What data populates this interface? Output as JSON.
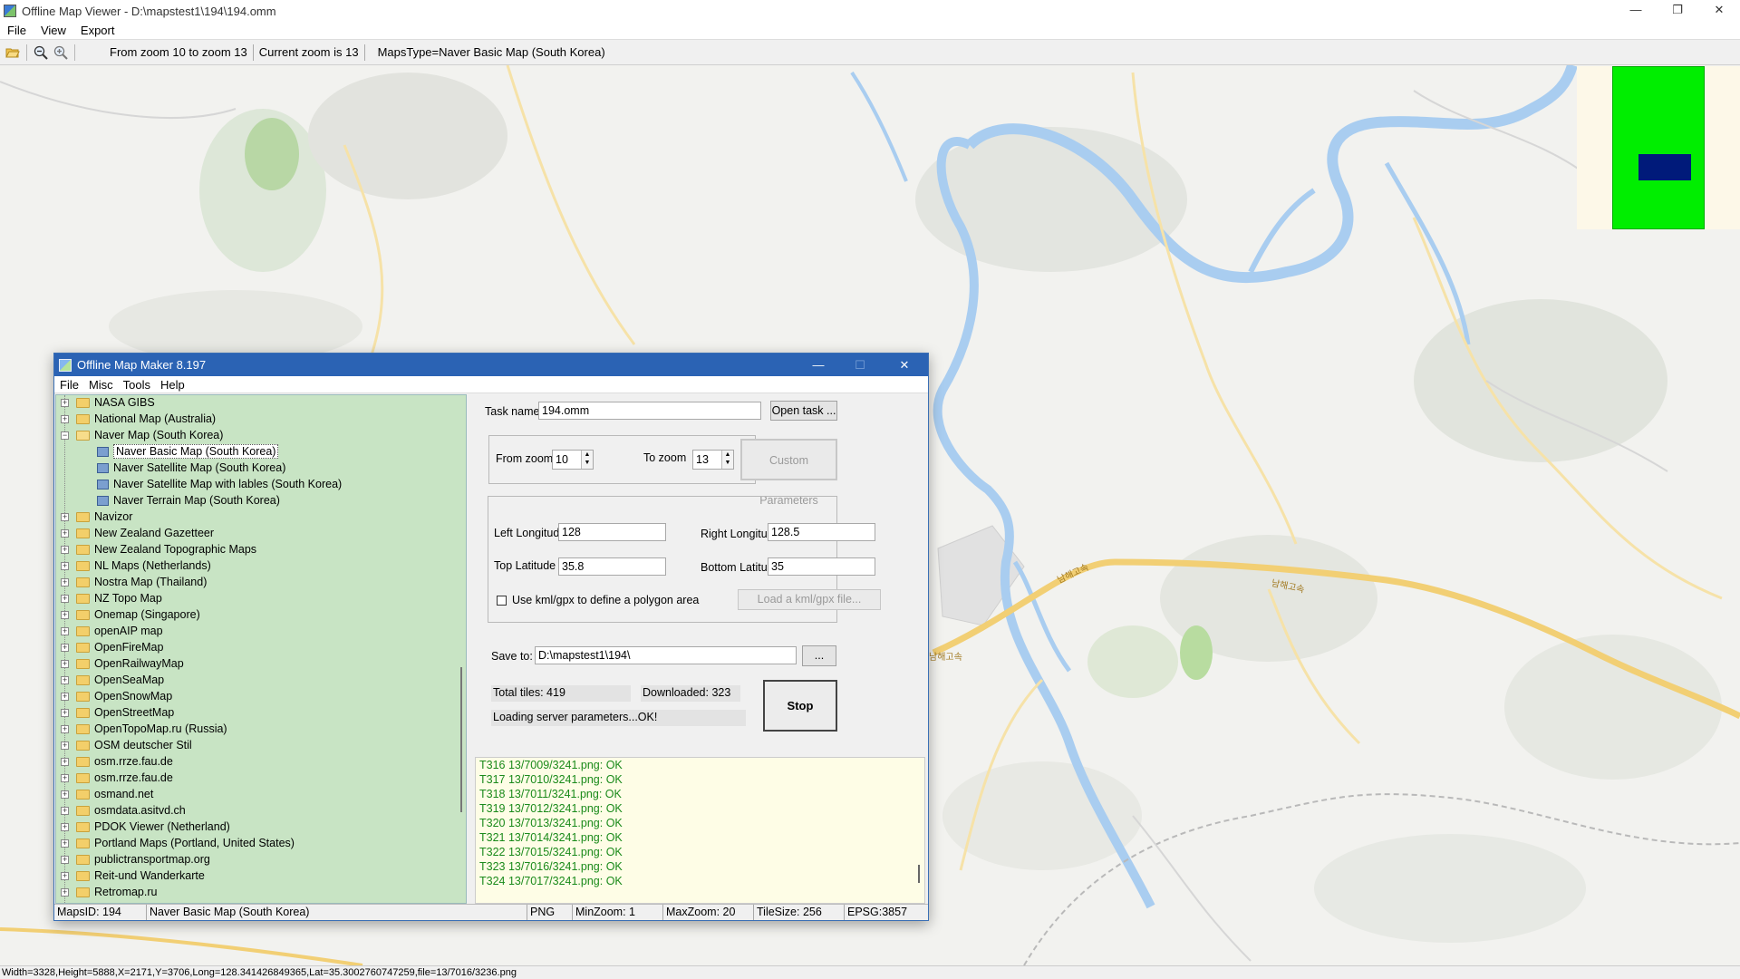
{
  "window": {
    "title": "Offline Map Viewer - D:\\mapstest1\\194\\194.omm",
    "controls": [
      "—",
      "❐",
      "✕"
    ]
  },
  "menu": [
    "File",
    "View",
    "Export"
  ],
  "toolbar": {
    "zoom_range": "From zoom 10 to zoom 13",
    "current_zoom": "Current zoom is 13",
    "maps_type": "MapsType=Naver Basic Map (South Korea)"
  },
  "map": {
    "labels": [
      "남해고속",
      "남해고속",
      "남해고속"
    ],
    "overview_colors": {
      "background": "#fdf8e8",
      "area": "#00ee00",
      "view": "#001a7a"
    }
  },
  "statusbar": {
    "text": "Width=3328,Height=5888,X=2171,Y=3706,Long=128.341426849365,Lat=35.3002760747259,file=13/7016/3236.png"
  },
  "dialog": {
    "title": "Offline Map Maker 8.197",
    "controls": [
      "—",
      "☐",
      "✕"
    ],
    "menu": [
      "File",
      "Misc",
      "Tools",
      "Help"
    ],
    "tree": [
      {
        "label": "NASA GIBS",
        "expander": "+"
      },
      {
        "label": "National Map (Australia)",
        "expander": "+"
      },
      {
        "label": "Naver Map (South Korea)",
        "expander": "−",
        "open": true
      },
      {
        "label": "Naver Basic Map (South Korea)",
        "child": true,
        "selected": true
      },
      {
        "label": "Naver Satellite Map (South Korea)",
        "child": true
      },
      {
        "label": "Naver Satellite Map with lables (South Korea)",
        "child": true
      },
      {
        "label": "Naver Terrain Map (South Korea)",
        "child": true
      },
      {
        "label": "Navizor",
        "expander": "+"
      },
      {
        "label": "New Zealand Gazetteer",
        "expander": "+"
      },
      {
        "label": "New Zealand Topographic Maps",
        "expander": "+"
      },
      {
        "label": "NL Maps (Netherlands)",
        "expander": "+"
      },
      {
        "label": "Nostra Map (Thailand)",
        "expander": "+"
      },
      {
        "label": "NZ Topo Map",
        "expander": "+"
      },
      {
        "label": "Onemap (Singapore)",
        "expander": "+"
      },
      {
        "label": "openAIP map",
        "expander": "+"
      },
      {
        "label": "OpenFireMap",
        "expander": "+"
      },
      {
        "label": "OpenRailwayMap",
        "expander": "+"
      },
      {
        "label": "OpenSeaMap",
        "expander": "+"
      },
      {
        "label": "OpenSnowMap",
        "expander": "+"
      },
      {
        "label": "OpenStreetMap",
        "expander": "+"
      },
      {
        "label": "OpenTopoMap.ru (Russia)",
        "expander": "+"
      },
      {
        "label": "OSM deutscher Stil",
        "expander": "+"
      },
      {
        "label": "osm.rrze.fau.de",
        "expander": "+"
      },
      {
        "label": "osm.rrze.fau.de",
        "expander": "+"
      },
      {
        "label": "osmand.net",
        "expander": "+"
      },
      {
        "label": "osmdata.asitvd.ch",
        "expander": "+"
      },
      {
        "label": "PDOK Viewer (Netherland)",
        "expander": "+"
      },
      {
        "label": "Portland Maps (Portland, United States)",
        "expander": "+"
      },
      {
        "label": "publictransportmap.org",
        "expander": "+"
      },
      {
        "label": "Reit-und Wanderkarte",
        "expander": "+"
      },
      {
        "label": "Retromap.ru",
        "expander": "+"
      }
    ],
    "task": {
      "label": "Task name",
      "value": "194.omm",
      "open_button": "Open task ..."
    },
    "zoom": {
      "from_label": "From zoom",
      "from_value": "10",
      "to_label": "To zoom",
      "to_value": "13",
      "custom_button": "Custom Parameters"
    },
    "bounds": {
      "left_label": "Left Longitude",
      "left_value": "128",
      "right_label": "Right Longitude",
      "right_value": "128.5",
      "top_label": "Top Latitude",
      "top_value": "35.8",
      "bottom_label": "Bottom Latitude",
      "bottom_value": "35",
      "kml_checkbox_label": "Use kml/gpx to define a polygon area",
      "kml_checked": false,
      "load_kml_button": "Load a kml/gpx file..."
    },
    "save": {
      "label": "Save to:",
      "value": "D:\\mapstest1\\194\\",
      "browse_button": "..."
    },
    "progress": {
      "total_tiles": "Total tiles: 419",
      "downloaded": "Downloaded: 323",
      "status": "Loading server parameters...OK!",
      "stop_button": "Stop"
    },
    "log": [
      "T316 13/7009/3241.png: OK",
      "T317 13/7010/3241.png: OK",
      "T318 13/7011/3241.png: OK",
      "T319 13/7012/3241.png: OK",
      "T320 13/7013/3241.png: OK",
      "T321 13/7014/3241.png: OK",
      "T322 13/7015/3241.png: OK",
      "T323 13/7016/3241.png: OK",
      "T324 13/7017/3241.png: OK"
    ],
    "status": {
      "maps_id": "MapsID: 194",
      "map_name": "Naver Basic Map (South Korea)",
      "format": "PNG",
      "min_zoom": "MinZoom: 1",
      "max_zoom": "MaxZoom: 20",
      "tile_size": "TileSize: 256",
      "epsg": "EPSG:3857"
    }
  }
}
